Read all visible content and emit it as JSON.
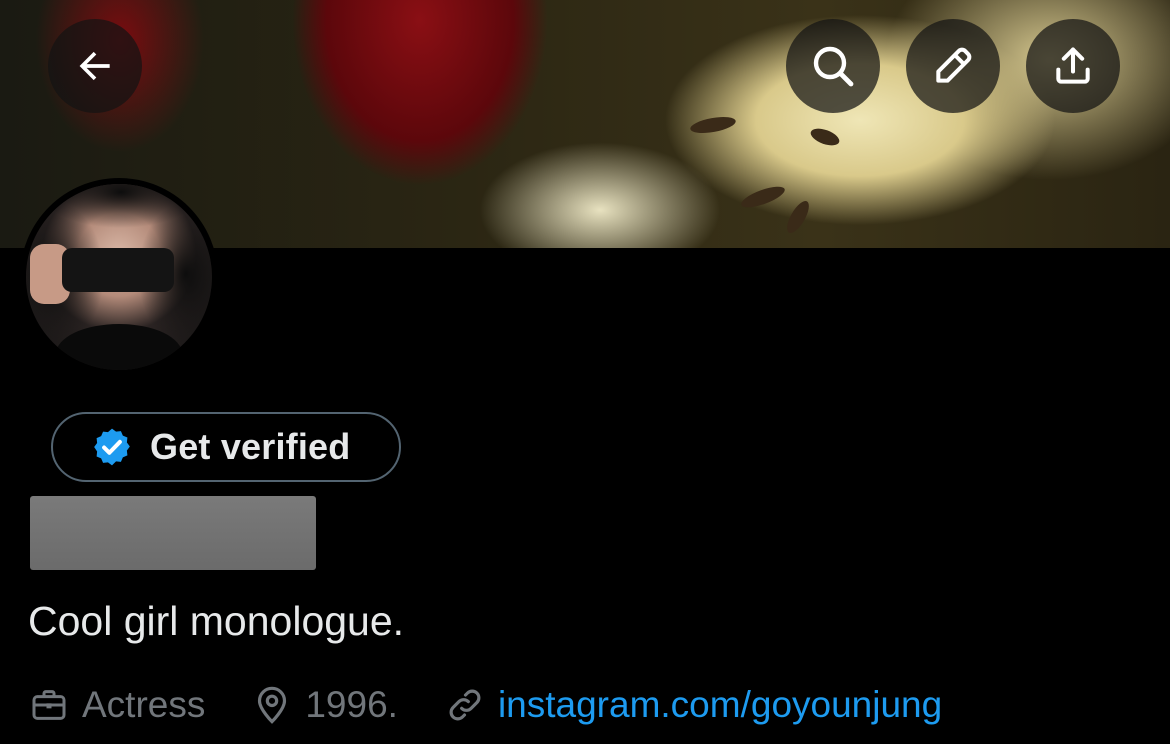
{
  "header": {
    "back_icon": "arrow-left-icon",
    "search_icon": "search-icon",
    "edit_icon": "pencil-icon",
    "share_icon": "share-upload-icon"
  },
  "profile": {
    "get_verified_label": "Get verified",
    "verified_icon": "verified-badge-icon",
    "verified_color": "#1d9bf0",
    "bio": "Cool girl monologue.",
    "meta": {
      "profession": "Actress",
      "location": "1996.",
      "link": "instagram.com/goyounjung"
    }
  },
  "colors": {
    "background": "#000000",
    "text_primary": "#e7e9ea",
    "text_secondary": "#71767b",
    "link": "#1d9bf0",
    "border": "#536471"
  }
}
